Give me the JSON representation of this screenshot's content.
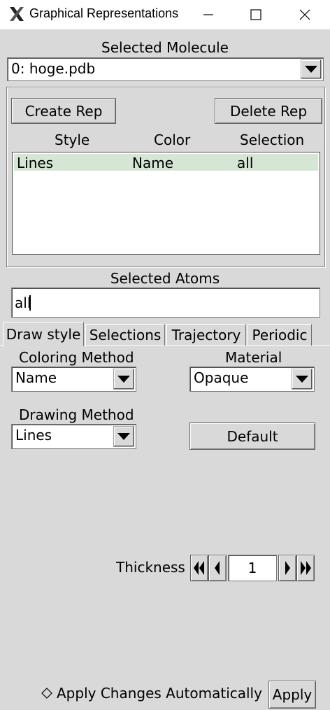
{
  "window": {
    "title": "Graphical Representations",
    "minimize": "—",
    "maximize": "☐",
    "close": "✕"
  },
  "molecule": {
    "label": "Selected Molecule",
    "selected": "0: hoge.pdb"
  },
  "reps": {
    "create_label": "Create Rep",
    "delete_label": "Delete Rep",
    "columns": [
      "Style",
      "Color",
      "Selection"
    ],
    "rows": [
      {
        "style": "Lines",
        "color": "Name",
        "selection": "all",
        "selected": true
      }
    ]
  },
  "atoms": {
    "label": "Selected Atoms",
    "value": "all"
  },
  "tabs": [
    {
      "label": "Draw style",
      "active": true
    },
    {
      "label": "Selections",
      "active": false
    },
    {
      "label": "Trajectory",
      "active": false
    },
    {
      "label": "Periodic",
      "active": false
    }
  ],
  "draw": {
    "coloring_label": "Coloring Method",
    "coloring_value": "Name",
    "material_label": "Material",
    "material_value": "Opaque",
    "drawing_label": "Drawing Method",
    "drawing_value": "Lines",
    "default_label": "Default",
    "thickness_label": "Thickness",
    "thickness_value": "1"
  },
  "footer": {
    "auto_label": "Apply Changes Automatically",
    "apply_label": "Apply"
  },
  "colors": {
    "background": "#d9d9d9",
    "selected_row": "#d5e6d5"
  }
}
